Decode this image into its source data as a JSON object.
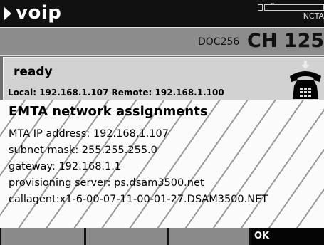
{
  "header": {
    "title": "voip",
    "battery_label": "E",
    "standard": "NCTA",
    "arrow_icon": "play-arrow-icon",
    "battery_icon": "battery-icon"
  },
  "channel": {
    "doc_label": "DOC256",
    "channel_label": "CH 125"
  },
  "status": {
    "text": "ready",
    "addresses": "Local: 192.168.1.107   Remote: 192.168.1.100",
    "phone_icon": "telephone-icon"
  },
  "dialog": {
    "heading": "EMTA network assignments",
    "lines": [
      "MTA IP address: 192.168.1.107",
      "subnet mask: 255.255.255.0",
      "gateway: 192.168.1.1",
      "provisioning server: ps.dsam3500.net",
      "callagent:x1-6-00-07-11-00-01-27.DSAM3500.NET"
    ]
  },
  "softkeys": [
    "",
    "",
    "",
    "OK"
  ],
  "colors": {
    "title_bar": "#111111",
    "channel_bar": "#8c8c8c",
    "status_panel": "#d2d2d2",
    "dialog_bg": "#fbfbfb",
    "softkey_gray": "#8a8a8a"
  }
}
